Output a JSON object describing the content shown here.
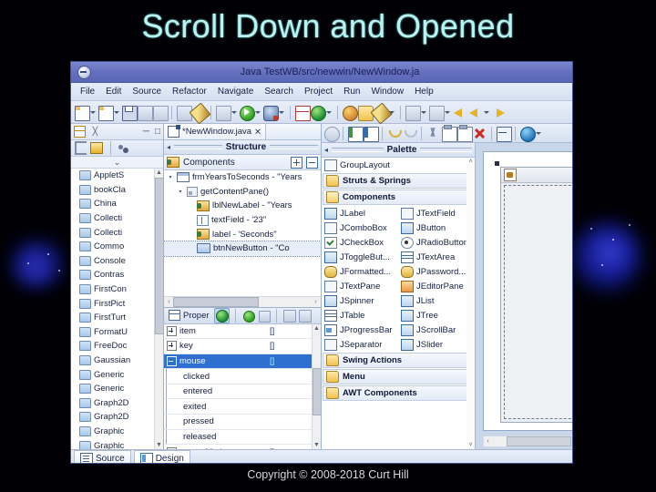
{
  "slide": {
    "title": "Scroll Down and Opened",
    "copyright": "Copyright © 2008-2018 Curt Hill",
    "title_color": "#b9f3f2",
    "background_color": "#000004"
  },
  "ide": {
    "window_title": "Java   TestWB/src/newwin/NewWindow.ja",
    "menu": [
      "File",
      "Edit",
      "Source",
      "Refactor",
      "Navigate",
      "Search",
      "Project",
      "Run",
      "Window",
      "Help"
    ],
    "main_toolbar_icons": [
      "new-file-icon",
      "new-file-dropdown",
      "new-wizard-icon",
      "new-wizard-dropdown",
      "save-icon",
      "save-all-icon",
      "print-icon",
      "build-icon",
      "link-icon",
      "external-tools-icon",
      "external-tools-dropdown",
      "run-icon",
      "run-dropdown",
      "debug-icon",
      "debug-dropdown",
      "new-java-project-icon",
      "refresh-icon",
      "refresh-dropdown",
      "open-type-icon",
      "open-resource-icon",
      "pencil-icon",
      "pencil-dropdown",
      "next-annotation-icon",
      "next-annotation-dropdown",
      "previous-annotation-icon",
      "previous-annotation-dropdown",
      "last-edit-icon",
      "back-icon",
      "back-dropdown",
      "forward-icon"
    ],
    "package_explorer": {
      "view_tab_icons": [
        "package-explorer-icon",
        "expand-icon"
      ],
      "view_controls": [
        "minimize-icon",
        "maximize-icon"
      ],
      "toolbar_icons": [
        "collapse-all-icon",
        "link-with-editor-icon",
        "view-menu-icon"
      ],
      "chevron": "⌄",
      "items": [
        "AppletS",
        "bookCla",
        "China",
        "Collecti",
        "Collecti",
        "Commo",
        "Console",
        "Contras",
        "FirstCon",
        "FirstPict",
        "FirstTurt",
        "FormatU",
        "FreeDoc",
        "Gaussian",
        "Generic",
        "Generic",
        "Graph2D",
        "Graph2D",
        "Graphic",
        "Graphic"
      ],
      "scroll_up": "▲",
      "scroll_down": "▼"
    },
    "editor_tab": {
      "label": "*NewWindow.java",
      "close_glyph": "⨯",
      "icon": "java-file-icon"
    },
    "structure_view": {
      "title": "Structure",
      "left_arrow": "◂",
      "header_label": "Components",
      "header_buttons": [
        "expand-all-icon",
        "collapse-all-icon"
      ],
      "tree": [
        {
          "indent": 0,
          "arrow": "▾",
          "icon": "frame-icon",
          "label": "frmYearsToSeconds - \"Years"
        },
        {
          "indent": 1,
          "arrow": "▾",
          "icon": "pane-icon",
          "label": "getContentPane()"
        },
        {
          "indent": 2,
          "arrow": "",
          "icon": "label-icon",
          "label": "lblNewLabel - \"Years"
        },
        {
          "indent": 2,
          "arrow": "",
          "icon": "textfield-icon",
          "label": "textField - '23\""
        },
        {
          "indent": 2,
          "arrow": "",
          "icon": "label-icon",
          "label": "label - 'Seconds\""
        },
        {
          "indent": 2,
          "arrow": "",
          "icon": "button-icon",
          "label": "btnNewButton - \"Co"
        }
      ],
      "selected_row_index": 5,
      "hscroll_left": "‹",
      "hscroll_right": "›"
    },
    "properties_view": {
      "tab_label": "Proper",
      "tab_icon": "properties-table-icon",
      "toolbar_icons": [
        "events-icon",
        "goto-definition-icon",
        "show-advanced-icon",
        "restore-default-icon",
        "sort-icon"
      ],
      "rows": [
        {
          "expander": "plus",
          "indent": 0,
          "name": "item",
          "value": "[]",
          "selected": false
        },
        {
          "expander": "plus",
          "indent": 0,
          "name": "key",
          "value": "[]",
          "selected": false
        },
        {
          "expander": "minus",
          "indent": 0,
          "name": "mouse",
          "value": "[]",
          "selected": true
        },
        {
          "expander": "none",
          "indent": 1,
          "name": "clicked",
          "value": "",
          "selected": false
        },
        {
          "expander": "none",
          "indent": 1,
          "name": "entered",
          "value": "",
          "selected": false
        },
        {
          "expander": "none",
          "indent": 1,
          "name": "exited",
          "value": "",
          "selected": false
        },
        {
          "expander": "none",
          "indent": 1,
          "name": "pressed",
          "value": "",
          "selected": false
        },
        {
          "expander": "none",
          "indent": 1,
          "name": "released",
          "value": "",
          "selected": false
        },
        {
          "expander": "plus",
          "indent": 0,
          "name": "mouseMoti...",
          "value": "[]",
          "selected": false
        }
      ],
      "scroll_up": "▲",
      "scroll_down": "▼"
    },
    "editor_toolbar_icons": [
      "selection-tool-icon",
      "marquee-icon",
      "test-icon",
      "refresh-icon",
      "undo-icon",
      "redo-icon",
      "cut-icon",
      "copy-icon",
      "paste-icon",
      "delete-icon",
      "fit-icon",
      "preview-icon",
      "preview-dropdown"
    ],
    "palette": {
      "title": "Palette",
      "left_arrow": "◂",
      "system_rows": [
        {
          "icon": "grouplayout-icon",
          "label": "GroupLayout",
          "bar": false
        },
        {
          "icon": "folder-icon",
          "label": "Struts & Springs",
          "bar": true
        },
        {
          "icon": "folder-open-icon",
          "label": "Components",
          "bar": true
        }
      ],
      "components": [
        [
          "JLabel",
          "JTextField"
        ],
        [
          "JComboBox",
          "JButton"
        ],
        [
          "JCheckBox",
          "JRadioButton"
        ],
        [
          "JToggleBut...",
          "JTextArea"
        ],
        [
          "JFormatted...",
          "JPassword..."
        ],
        [
          "JTextPane",
          "JEditorPane"
        ],
        [
          "JSpinner",
          "JList"
        ],
        [
          "JTable",
          "JTree"
        ],
        [
          "JProgressBar",
          "JScrollBar"
        ],
        [
          "JSeparator",
          "JSlider"
        ]
      ],
      "groups": [
        "Swing Actions",
        "Menu",
        "AWT Components"
      ],
      "scroll_up": "˄",
      "scroll_down": "˅"
    },
    "design_canvas": {
      "preview_title_icon": "java-cup-icon",
      "hscroll_left": "‹"
    },
    "bottom_tabs": [
      {
        "label": "Source",
        "icon": "source-icon",
        "selected": false
      },
      {
        "label": "Design",
        "icon": "design-icon",
        "selected": true
      }
    ]
  }
}
